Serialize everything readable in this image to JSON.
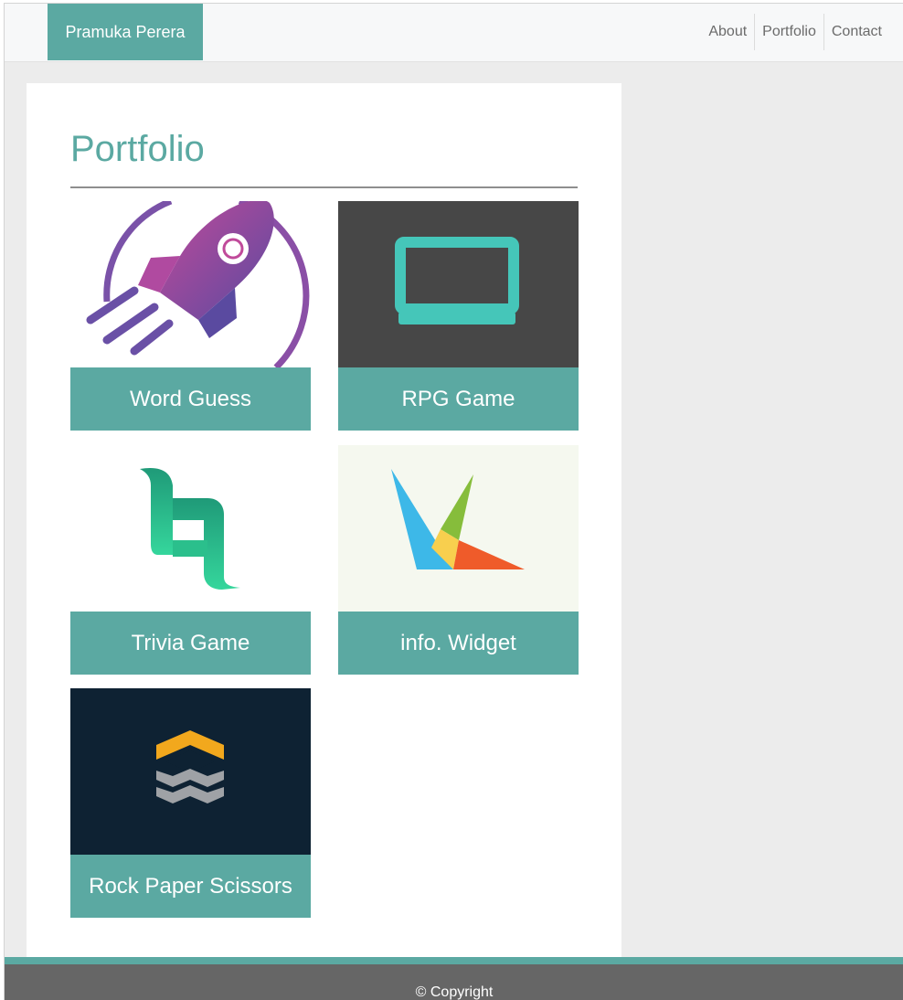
{
  "nav": {
    "brand": "Pramuka Perera",
    "links": [
      "About",
      "Portfolio",
      "Contact"
    ]
  },
  "main": {
    "title": "Portfolio",
    "projects": [
      {
        "label": "Word Guess",
        "icon": "rocket-icon"
      },
      {
        "label": "RPG Game",
        "icon": "laptop-icon"
      },
      {
        "label": "Trivia Game",
        "icon": "q-letter-logo-icon"
      },
      {
        "label": "info. Widget",
        "icon": "geometric-triangles-logo-icon"
      },
      {
        "label": "Rock Paper Scissors",
        "icon": "layered-chevrons-logo-icon"
      }
    ]
  },
  "footer": {
    "text": "© Copyright"
  },
  "colors": {
    "accent": "#5ba9a2",
    "footer": "#666666",
    "background": "#ececec"
  }
}
